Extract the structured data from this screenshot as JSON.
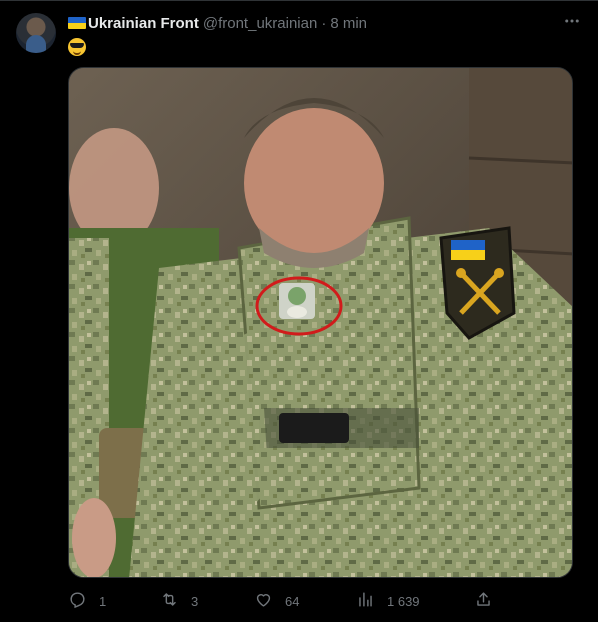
{
  "tweet": {
    "author": {
      "display_name": "Ukrainian Front",
      "handle": "@front_ukrainian",
      "flag_icon": "ukraine-flag-icon"
    },
    "separator": "·",
    "time": "8 min",
    "text_emoji": "smiling-face-with-sunglasses-emoji",
    "more_icon": "more-horizontal-icon"
  },
  "actions": {
    "reply_count": "1",
    "retweet_count": "3",
    "like_count": "64",
    "view_count": "1 639"
  },
  "colors": {
    "background": "#000000",
    "primary_text": "#e7e9ea",
    "secondary_text": "#71767b",
    "border": "#2f3336"
  }
}
